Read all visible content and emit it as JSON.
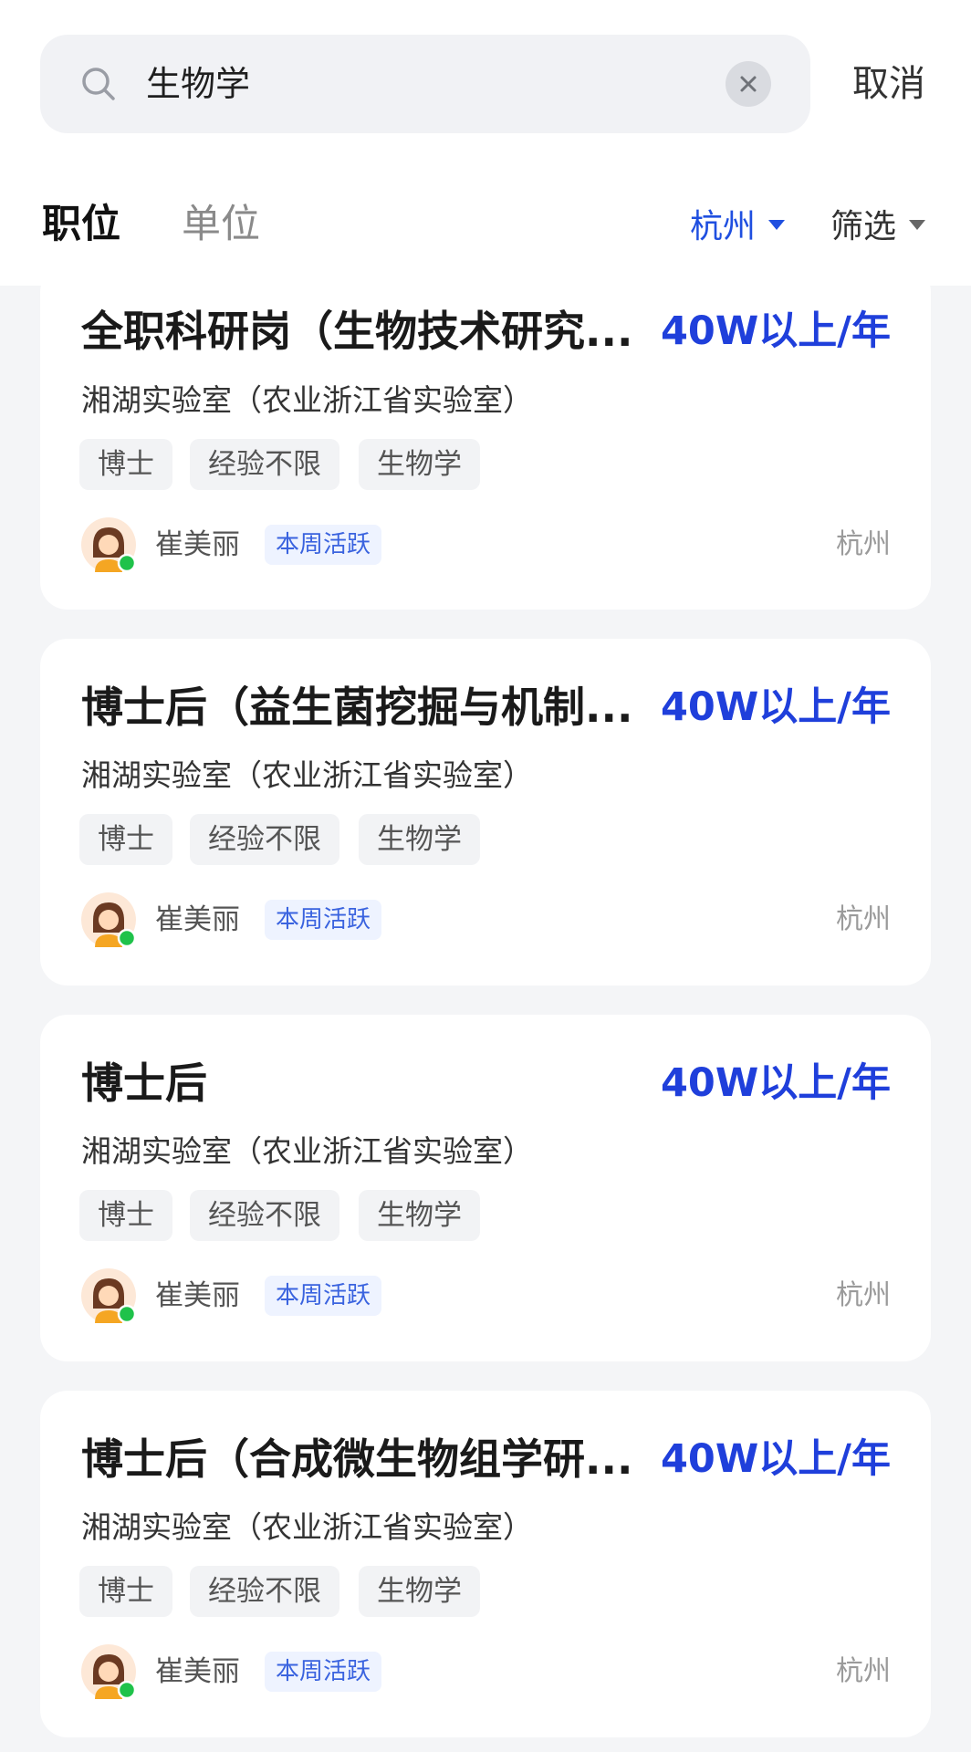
{
  "search": {
    "query": "生物学",
    "cancel_label": "取消"
  },
  "tabs": [
    {
      "label": "职位",
      "active": true
    },
    {
      "label": "单位",
      "active": false
    }
  ],
  "filters": {
    "city": "杭州",
    "filter_label": "筛选"
  },
  "colors": {
    "accent": "#1f4fe0",
    "salary": "#1f3fdb",
    "online_dot": "#1fc24a",
    "badge_bg": "#eef3ff"
  },
  "jobs": [
    {
      "title": "全职科研岗（生物技术研究...",
      "salary": "40W以上/年",
      "company": "湘湖实验室（农业浙江省实验室）",
      "tags": [
        "博士",
        "经验不限",
        "生物学"
      ],
      "recruiter": "崔美丽",
      "badge": "本周活跃",
      "location": "杭州"
    },
    {
      "title": "博士后（益生菌挖掘与机制...",
      "salary": "40W以上/年",
      "company": "湘湖实验室（农业浙江省实验室）",
      "tags": [
        "博士",
        "经验不限",
        "生物学"
      ],
      "recruiter": "崔美丽",
      "badge": "本周活跃",
      "location": "杭州"
    },
    {
      "title": "博士后",
      "salary": "40W以上/年",
      "company": "湘湖实验室（农业浙江省实验室）",
      "tags": [
        "博士",
        "经验不限",
        "生物学"
      ],
      "recruiter": "崔美丽",
      "badge": "本周活跃",
      "location": "杭州"
    },
    {
      "title": "博士后（合成微生物组学研...",
      "salary": "40W以上/年",
      "company": "湘湖实验室（农业浙江省实验室）",
      "tags": [
        "博士",
        "经验不限",
        "生物学"
      ],
      "recruiter": "崔美丽",
      "badge": "本周活跃",
      "location": "杭州"
    }
  ]
}
